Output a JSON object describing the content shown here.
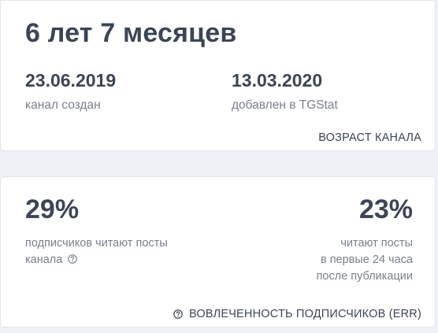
{
  "age_card": {
    "title": "6 лет 7 месяцев",
    "created_date": "23.06.2019",
    "created_label": "канал создан",
    "added_date": "13.03.2020",
    "added_label": "добавлен в TGStat",
    "footer_label": "ВОЗРАСТ КАНАЛА"
  },
  "err_card": {
    "left_percent": "29%",
    "left_line1": "подписчиков читают посты",
    "left_line2": "канала",
    "right_percent": "23%",
    "right_line1": "читают посты",
    "right_line2": "в первые 24 часа",
    "right_line3": "после публикации",
    "footer_label": "ВОВЛЕЧЕННОСТЬ ПОДПИСЧИКОВ (ERR)"
  },
  "icons": {
    "help": "question-circle-icon"
  },
  "colors": {
    "background": "#eef1f5",
    "card": "#ffffff",
    "primary_text": "#3c4456",
    "muted_text": "#7a808c"
  }
}
